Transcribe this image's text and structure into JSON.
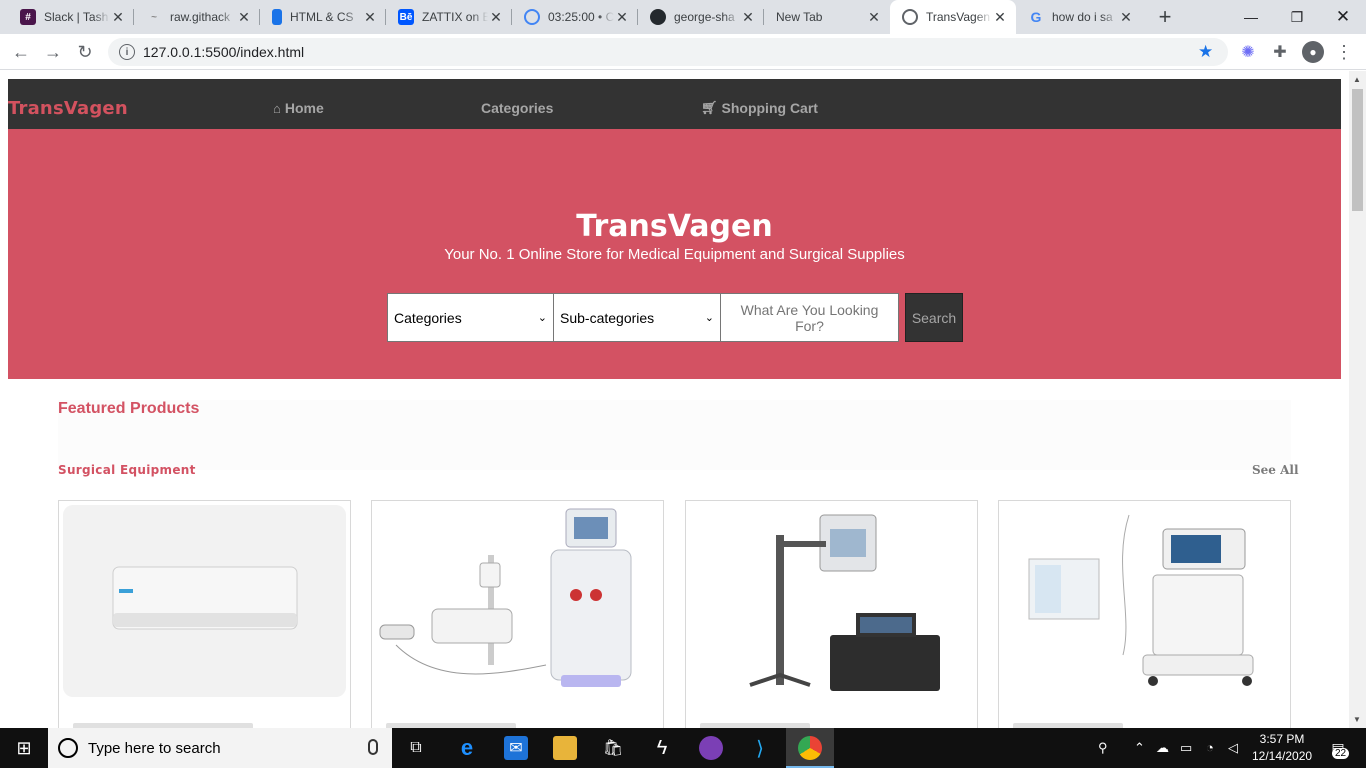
{
  "browser": {
    "tabs": [
      {
        "title": "Slack | Tash",
        "icon": "slack-icon",
        "color": "#4a154b"
      },
      {
        "title": "raw.githack",
        "icon": "githack-icon",
        "color": "#888888"
      },
      {
        "title": "HTML & CS",
        "icon": "phone-icon",
        "color": "#1a73e8"
      },
      {
        "title": "ZATTIX on B",
        "icon": "behance-icon",
        "color": "#0057ff"
      },
      {
        "title": "03:25:00 • C",
        "icon": "timer-icon",
        "color": "#4285f4"
      },
      {
        "title": "george-sha",
        "icon": "github-icon",
        "color": "#24292e"
      },
      {
        "title": "New Tab",
        "icon": "",
        "color": ""
      },
      {
        "title": "TransVagen",
        "icon": "globe-icon",
        "color": "#5f6368"
      },
      {
        "title": "how do i sa",
        "icon": "google-icon",
        "color": "#4285f4"
      }
    ],
    "url": "127.0.0.1:5500/index.html"
  },
  "site": {
    "brand": "TransVagen",
    "nav": {
      "home": "Home",
      "categories": "Categories",
      "cart": "Shopping Cart"
    },
    "hero": {
      "title": "TransVagen",
      "subtitle": "Your No. 1 Online Store for Medical Equipment and Surgical Supplies"
    },
    "search": {
      "category_value": "Categories",
      "subcategory_value": "Sub-categories",
      "placeholder": "What Are You Looking For?",
      "button": "Search"
    },
    "featured_title": "Featured Products",
    "section": {
      "title": "Surgical Equipment",
      "see_all": "See All"
    },
    "products": [
      {
        "image": "air-conditioner-image"
      },
      {
        "image": "dialysis-machine-image"
      },
      {
        "image": "mobile-xray-image"
      },
      {
        "image": "ventilator-image"
      }
    ]
  },
  "taskbar": {
    "search_placeholder": "Type here to search",
    "time": "3:57 PM",
    "date": "12/14/2020",
    "notifications": "22"
  },
  "colors": {
    "brand": "#d35263",
    "nav_bg": "#333333"
  }
}
